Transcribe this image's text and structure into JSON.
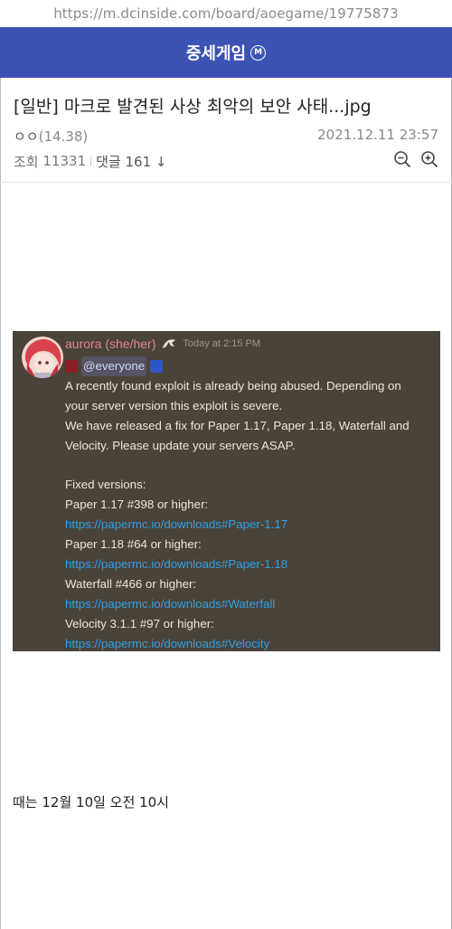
{
  "browser": {
    "url": "https://m.dcinside.com/board/aoegame/19775873"
  },
  "gallery": {
    "name": "중세게임",
    "minor_badge": "M",
    "header_color": "#3d53b3"
  },
  "post": {
    "title": "[일반] 마크로 발견된 사상 최악의 보안 사태...jpg",
    "author": "ㅇㅇ",
    "author_ip": "(14.38)",
    "datetime": "2021.12.11 23:57",
    "views_label": "조회",
    "views": "11331",
    "comments_label": "댓글",
    "comments": "161",
    "comments_arrow": "↓"
  },
  "discord": {
    "username": "aurora (she/her)",
    "timestamp": "Today at 2:15 PM",
    "mention": "@everyone",
    "lines": [
      {
        "text": "A recently found exploit is already being abused. Depending on",
        "type": "text"
      },
      {
        "text": "your server version this exploit is severe.",
        "type": "text"
      },
      {
        "text": "We have released a fix for Paper 1.17, Paper 1.18, Waterfall and",
        "type": "text"
      },
      {
        "text": "Velocity. Please update your servers ASAP.",
        "type": "text"
      },
      {
        "text": "",
        "type": "blank"
      },
      {
        "text": "Fixed versions:",
        "type": "text"
      },
      {
        "text": "Paper 1.17 #398 or higher:",
        "type": "text"
      },
      {
        "text": "https://papermc.io/downloads#Paper-1.17",
        "type": "link"
      },
      {
        "text": "Paper 1.18 #64 or higher:",
        "type": "text"
      },
      {
        "text": "https://papermc.io/downloads#Paper-1.18",
        "type": "link"
      },
      {
        "text": "Waterfall #466 or higher:",
        "type": "text"
      },
      {
        "text": "https://papermc.io/downloads#Waterfall",
        "type": "link"
      },
      {
        "text": "Velocity 3.1.1 #97 or higher:",
        "type": "text"
      },
      {
        "text": "https://papermc.io/downloads#Velocity",
        "type": "link"
      }
    ]
  },
  "caption": "때는 12월 10일 오전 10시",
  "icons": {
    "zoom_out": "zoom-out-icon",
    "zoom_in": "zoom-in-icon"
  }
}
